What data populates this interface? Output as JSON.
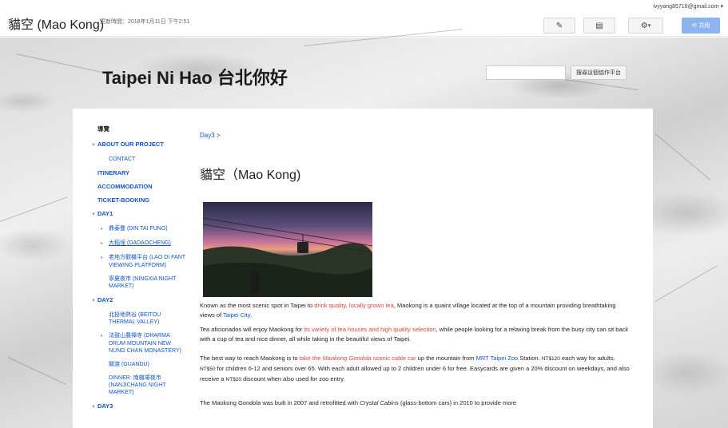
{
  "header": {
    "doc_title": "貓空 (Mao Kong)",
    "updated": "更新時間：2018年1月11日 下午2:51",
    "email": "ivyyang85716@gmail.com",
    "share_label": "共用"
  },
  "site": {
    "title": "Taipei Ni Hao 台北你好",
    "search_placeholder": "",
    "search_button": "搜尋這個協作平台"
  },
  "nav": {
    "heading": "導覽",
    "items": [
      {
        "label": "ABOUT OUR PROJECT"
      },
      {
        "label": "CONTACT"
      },
      {
        "label": "ITINERARY"
      },
      {
        "label": "ACCOMMODATION"
      },
      {
        "label": "TICKET-BOOKING"
      },
      {
        "label": "DAY1"
      },
      {
        "label": "鼎泰豐 (DIN TAI FUNG)"
      },
      {
        "label": "大稻埕 (DADAOCHENG)"
      },
      {
        "label": "老地方觀機平台 (LAO DI FANT VIEWING PLATFORM)"
      },
      {
        "label": "寧夏夜市 (NINGXIA NIGHT MARKET)"
      },
      {
        "label": "DAY2"
      },
      {
        "label": "北投地熱谷 (BEITOU THERMAL VALLEY)"
      },
      {
        "label": "法鼓山農禪寺 (DHARMA DRUM MOUNTAIN NEW NUNG CHAN MONASTERY)"
      },
      {
        "label": "關渡 (GUANDU)"
      },
      {
        "label": "DINNER: 南機場夜市 (NANJICHANG NIGHT MARKET)"
      },
      {
        "label": "DAY3"
      }
    ]
  },
  "main": {
    "breadcrumb": "Day3 >",
    "heading": "貓空（Mao Kong)",
    "p1": {
      "a": "Known as the most scenic spot in Taipei to ",
      "b": "drink quality, locally grown tea",
      "c": ", Maokong is a quaint village located at the top of a mountain providing breathtaking views of ",
      "d": "Taipei City",
      "e": "."
    },
    "p2": {
      "a": "Tea aficionados will enjoy Maokong for ",
      "b": "its variety of tea houses and high quality selection",
      "c": ", while people looking for a relaxing break from the busy city can sit back with a cup of tea and nice dinner, all while taking in the beautiful views of Taipei."
    },
    "p3": {
      "a": "The best way to reach Maokong is to ",
      "b": "take the ",
      "c": "Maokong Gondola",
      "d": " scenic cable car",
      "e": " up the mountain from ",
      "f": "MRT Taipei Zoo",
      "g": " Station. ",
      "h": "NT$120",
      "i": " each way for adults. ",
      "j": "NT$50",
      "k": " for children 6-12 and seniors over 65. With each adult allowed up to 2 children under 6 for free. Easycards are given a 20% discount on weekdays, and also receive a ",
      "l": "NT$20",
      "m": " discount when also used for zoo entry."
    },
    "p4": {
      "a": "The Maokong Gondola was built in 2007 and retrofitted with ",
      "b": "Crystal Cabins",
      "c": " (glass-bottom cars) in 2010 to provide more"
    }
  }
}
